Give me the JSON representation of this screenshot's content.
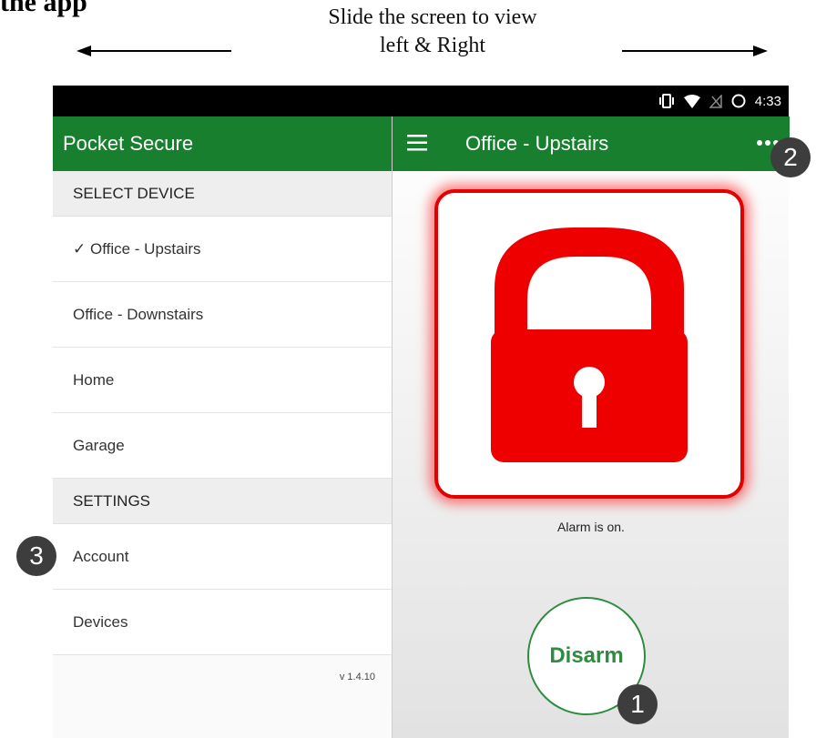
{
  "doc": {
    "heading": "the app",
    "slide_instruction_line1": "Slide the screen to view",
    "slide_instruction_line2": "left & Right"
  },
  "status_bar": {
    "time": "4:33",
    "icons": [
      "vibrate-icon",
      "wifi-icon",
      "no-signal-icon",
      "battery-icon"
    ]
  },
  "drawer": {
    "app_name": "Pocket Secure",
    "select_device_header": "SELECT DEVICE",
    "devices": [
      {
        "label": "✓ Office - Upstairs",
        "selected": true
      },
      {
        "label": "Office - Downstairs",
        "selected": false
      },
      {
        "label": "Home",
        "selected": false
      },
      {
        "label": "Garage",
        "selected": false
      }
    ],
    "settings_header": "SETTINGS",
    "settings_items": [
      {
        "label": "Account"
      },
      {
        "label": "Devices"
      }
    ],
    "version": "v 1.4.10"
  },
  "main": {
    "title": "Office - Upstairs",
    "alarm_status": "Alarm is on.",
    "disarm_label": "Disarm"
  },
  "callouts": [
    "1",
    "2",
    "3"
  ],
  "colors": {
    "brand_green": "#177f2e",
    "lock_red": "#e30000",
    "callout_gray": "#3d3d3d"
  }
}
